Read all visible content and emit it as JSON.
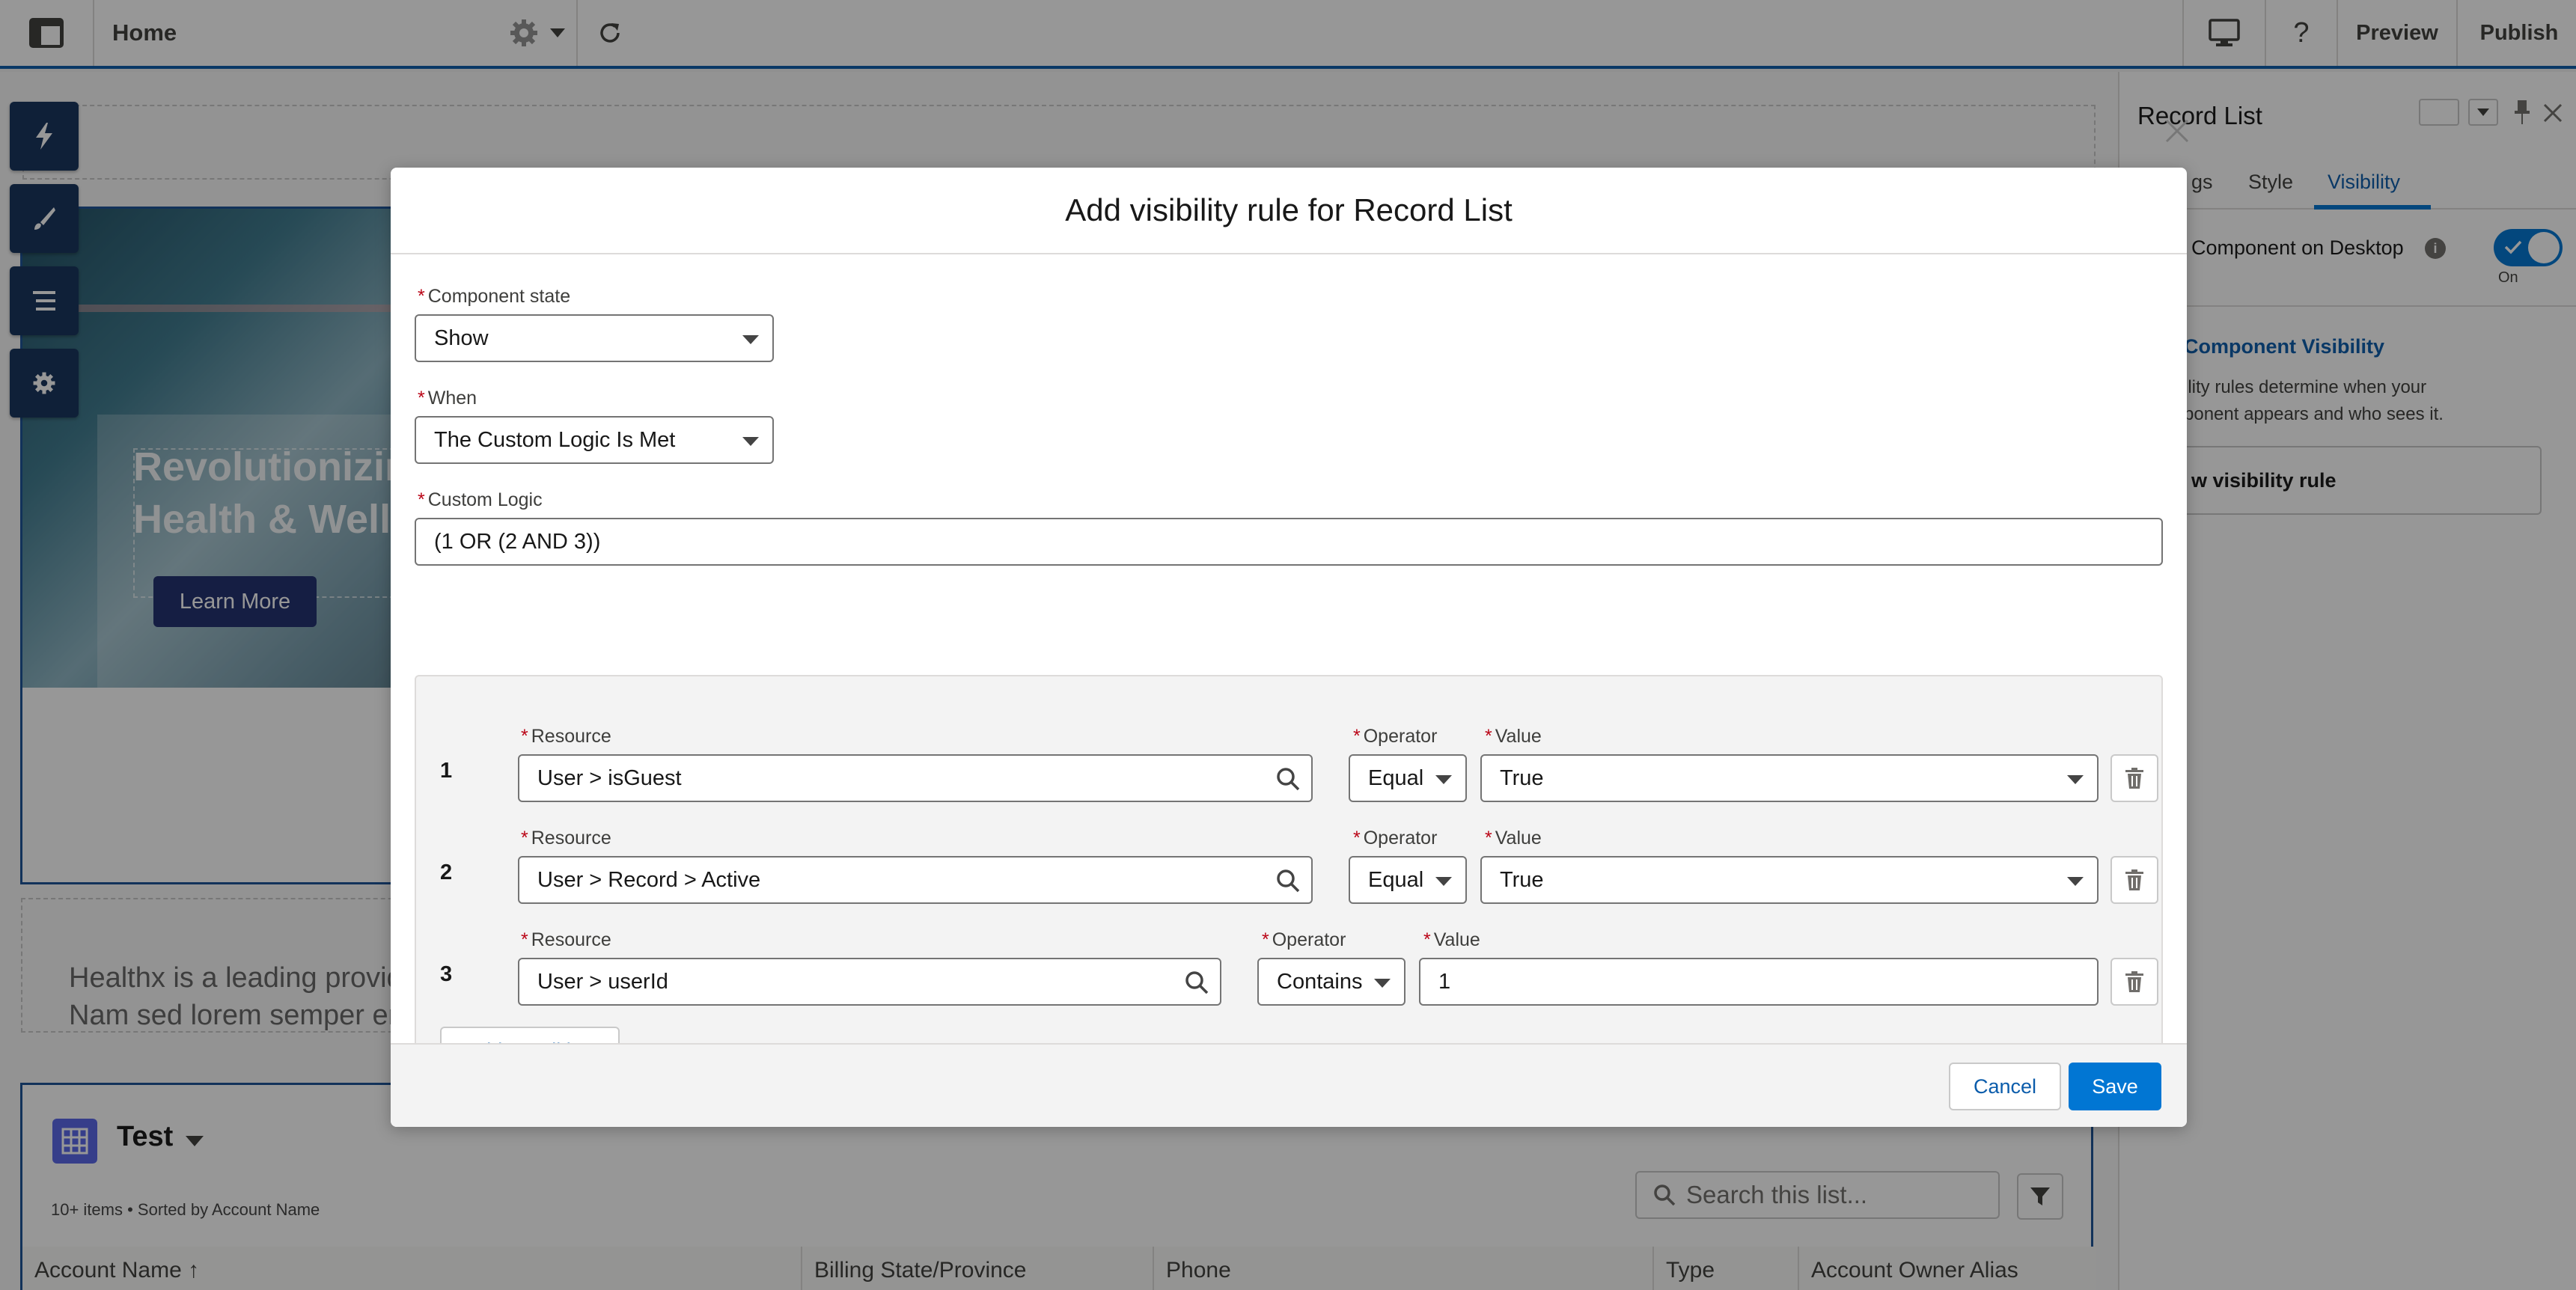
{
  "topbar": {
    "page_title": "Home",
    "preview_label": "Preview",
    "publish_label": "Publish"
  },
  "hero": {
    "title": "Revolutionizin\nHealth & Welln",
    "button_label": "Learn More"
  },
  "about": {
    "text": "Healthx is a leading provide\nNam sed lorem semper era"
  },
  "record_list": {
    "title": "Test",
    "meta": "10+ items • Sorted by Account Name",
    "search_placeholder": "Search this list...",
    "columns": [
      "Account Name ↑",
      "Billing State/Province",
      "Phone",
      "Type",
      "Account Owner Alias"
    ]
  },
  "right_panel": {
    "title": "Record List",
    "tabs": [
      "gs",
      "Style",
      "Visibility"
    ],
    "active_tab": "Visibility",
    "toggle_label": "Component on Desktop",
    "toggle_state": "On",
    "section_title": "Component Visibility",
    "section_desc": "ility rules determine when your\nponent appears and who sees it.",
    "add_rule_label": "w visibility rule"
  },
  "modal": {
    "title": "Add visibility rule for Record List",
    "component_state": {
      "label": "Component state",
      "value": "Show"
    },
    "when": {
      "label": "When",
      "value": "The Custom Logic Is Met"
    },
    "custom_logic": {
      "label": "Custom Logic",
      "value": "(1 OR (2 AND 3))"
    },
    "conditions": [
      {
        "num": "1",
        "resource_label": "Resource",
        "resource": "User > isGuest",
        "operator_label": "Operator",
        "operator": "Equal",
        "value_label": "Value",
        "value": "True"
      },
      {
        "num": "2",
        "resource_label": "Resource",
        "resource": "User > Record > Active",
        "operator_label": "Operator",
        "operator": "Equal",
        "value_label": "Value",
        "value": "True"
      },
      {
        "num": "3",
        "resource_label": "Resource",
        "resource": "User > userId",
        "operator_label": "Operator",
        "operator": "Contains",
        "value_label": "Value",
        "value": "1"
      }
    ],
    "add_condition_label": "Add Condition",
    "cancel_label": "Cancel",
    "save_label": "Save"
  },
  "colors": {
    "brand": "#0176d3",
    "nav_dark": "#16325c",
    "selection_border": "#1b5297",
    "required": "#ba0517"
  }
}
